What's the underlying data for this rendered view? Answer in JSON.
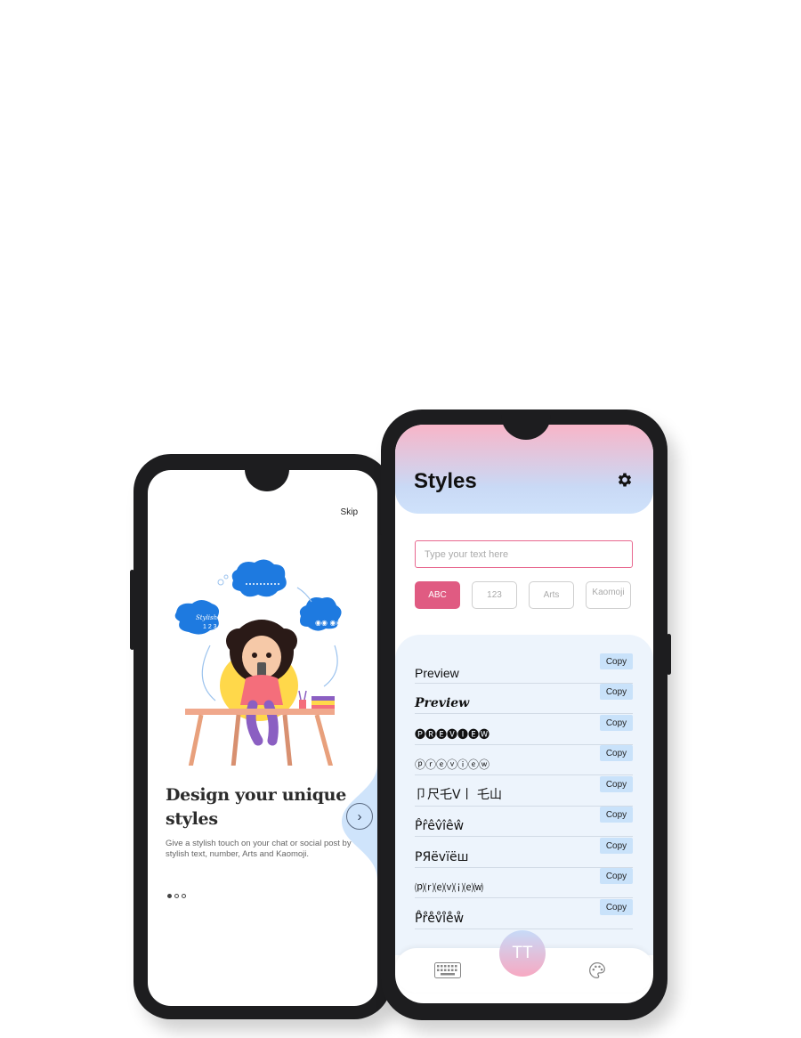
{
  "onboarding": {
    "skip_label": "Skip",
    "headline": "Design your unique styles",
    "subtext": "Give a stylish touch on your chat or social post by stylish text, number, Arts and Kaomoji.",
    "next_label": "›",
    "page_indicator": {
      "current": 1,
      "total": 3
    },
    "illustration": {
      "cloud_left_text": "Stylish Fonts",
      "cloud_left_number": "1 2 3",
      "cloud_right_text": "◉◉ ◉◉"
    }
  },
  "styles_screen": {
    "title": "Styles",
    "settings_icon": "gear-icon",
    "input_placeholder": "Type your text here",
    "tabs": [
      {
        "label": "ABC",
        "active": true
      },
      {
        "label": "123",
        "active": false
      },
      {
        "label": "Arts",
        "active": false
      },
      {
        "label": "Kaomoji",
        "active": false
      }
    ],
    "copy_label": "Copy",
    "styles": [
      "Preview",
      "Preview",
      "🅟🅡🅔🅥🅘🅔🅦",
      "ⓟⓡⓔⓥⓘⓔⓦ",
      "卩尺乇V丨 乇山",
      "P̂r̂êv̂îêŵ",
      "PЯёvїёш",
      "⒫⒭⒠⒱⒤⒠⒲",
      "P̊r̊e̊v̊i̊e̊ẘ"
    ],
    "bottom_nav": {
      "left_icon": "keyboard-icon",
      "center_label": "TT",
      "right_icon": "palette-icon"
    }
  },
  "colors": {
    "accent_pink": "#e05b82",
    "copy_bg": "#c9e2fa",
    "frame": "#1d1d1f",
    "panel_bg": "#edf4fc"
  }
}
